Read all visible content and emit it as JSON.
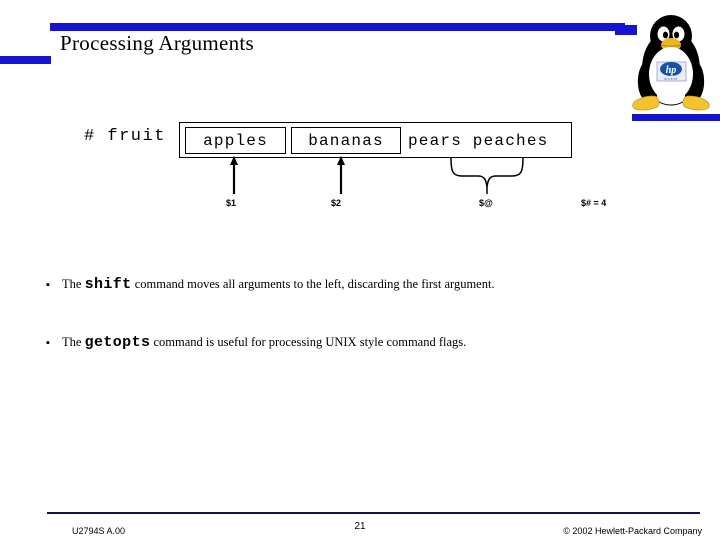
{
  "slide": {
    "title": "Processing Arguments",
    "accent_color": "#1414d2",
    "footer_rule_color": "#101060"
  },
  "logo": {
    "name": "tux-hp-invent-logo",
    "brand_text": "invent"
  },
  "diagram": {
    "prompt": "# fruit",
    "arguments": [
      {
        "label": "apples",
        "boxed": true
      },
      {
        "label": "bananas",
        "boxed": true
      },
      {
        "label": "pears peaches",
        "boxed": false
      }
    ],
    "plain_text": "pears peaches",
    "var_labels": [
      {
        "name": "arg1",
        "text": "$1"
      },
      {
        "name": "arg2",
        "text": "$2"
      },
      {
        "name": "argat",
        "text": "$@"
      },
      {
        "name": "argcount",
        "text": "$# = 4"
      }
    ]
  },
  "bullets": [
    {
      "prefix": "The ",
      "command": "shift",
      "suffix": " command moves all arguments to the left, discarding the first argument."
    },
    {
      "prefix": "The ",
      "command": "getopts",
      "suffix": " command is useful for processing UNIX style command flags."
    }
  ],
  "footer": {
    "course_code": "U2794S A.00",
    "page_number": "21",
    "copyright": "© 2002 Hewlett-Packard Company"
  }
}
